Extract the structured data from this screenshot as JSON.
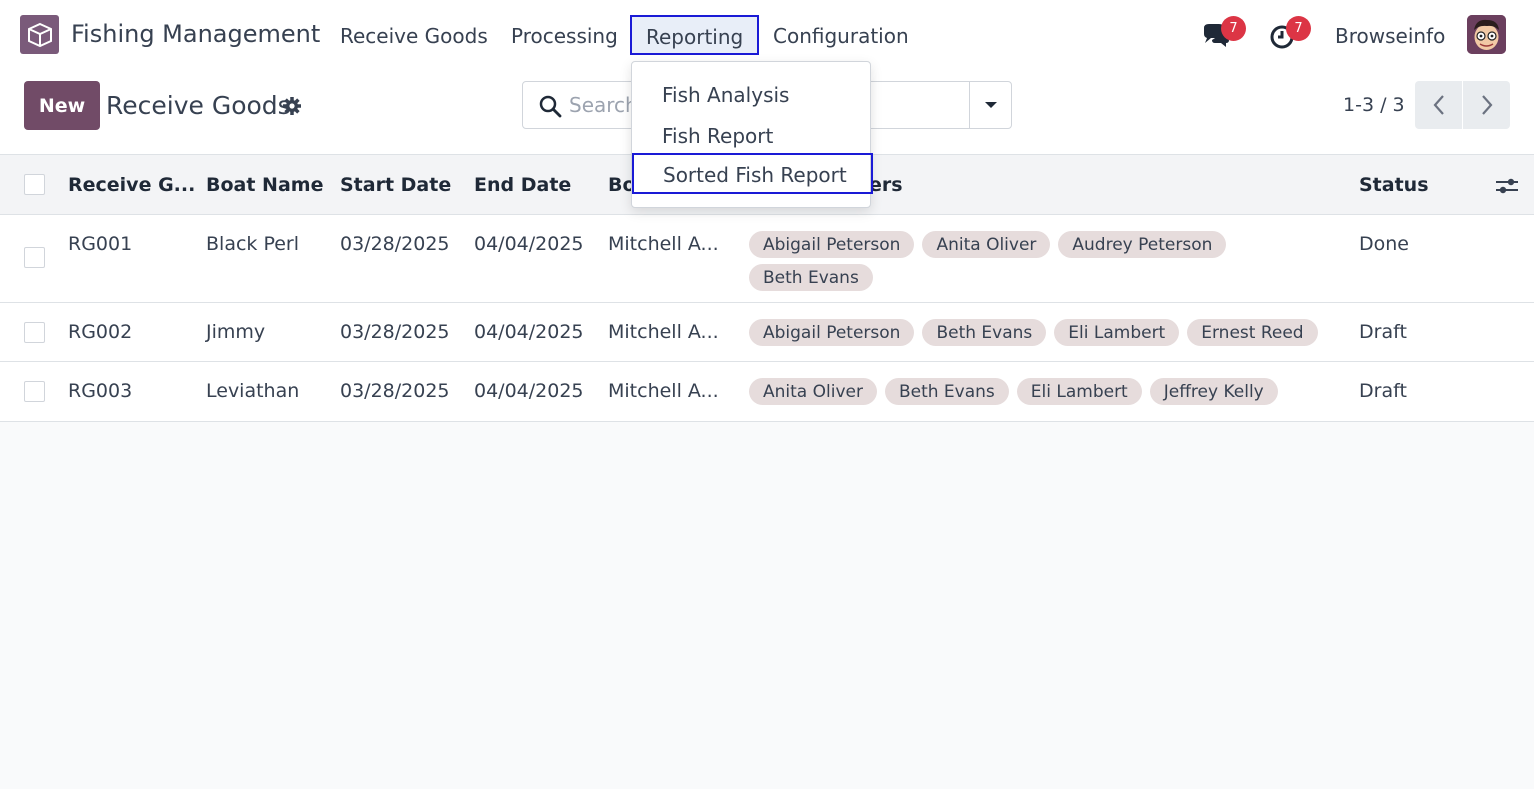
{
  "navbar": {
    "app_name": "Fishing Management",
    "menus": [
      "Receive Goods",
      "Processing",
      "Reporting",
      "Configuration"
    ],
    "messages_count": "7",
    "activities_count": "7",
    "user_name": "Browseinfo"
  },
  "reporting_menu": {
    "items": [
      "Fish Analysis",
      "Fish Report",
      "Sorted Fish Report"
    ]
  },
  "control_panel": {
    "new_label": "New",
    "title": "Receive Goods",
    "search_placeholder": "Search...",
    "pager": "1-3 / 3"
  },
  "table": {
    "columns": [
      "Receive G...",
      "Boat Name",
      "Start Date",
      "End Date",
      "Bo",
      "ers",
      "Status"
    ],
    "rows": [
      {
        "ref": "RG001",
        "boat": "Black Perl",
        "start": "03/28/2025",
        "end": "04/04/2025",
        "boatman": "Mitchell A...",
        "workers": [
          "Abigail Peterson",
          "Anita Oliver",
          "Audrey Peterson",
          "Beth Evans"
        ],
        "status": "Done"
      },
      {
        "ref": "RG002",
        "boat": "Jimmy",
        "start": "03/28/2025",
        "end": "04/04/2025",
        "boatman": "Mitchell A...",
        "workers": [
          "Abigail Peterson",
          "Beth Evans",
          "Eli Lambert",
          "Ernest Reed"
        ],
        "status": "Draft"
      },
      {
        "ref": "RG003",
        "boat": "Leviathan",
        "start": "03/28/2025",
        "end": "04/04/2025",
        "boatman": "Mitchell A...",
        "workers": [
          "Anita Oliver",
          "Beth Evans",
          "Eli Lambert",
          "Jeffrey Kelly"
        ],
        "status": "Draft"
      }
    ]
  },
  "colors": {
    "brand": "#714b67",
    "badge": "#dc3545",
    "highlight_border": "#1a1ad6",
    "tag_bg": "#e6dcdc"
  }
}
